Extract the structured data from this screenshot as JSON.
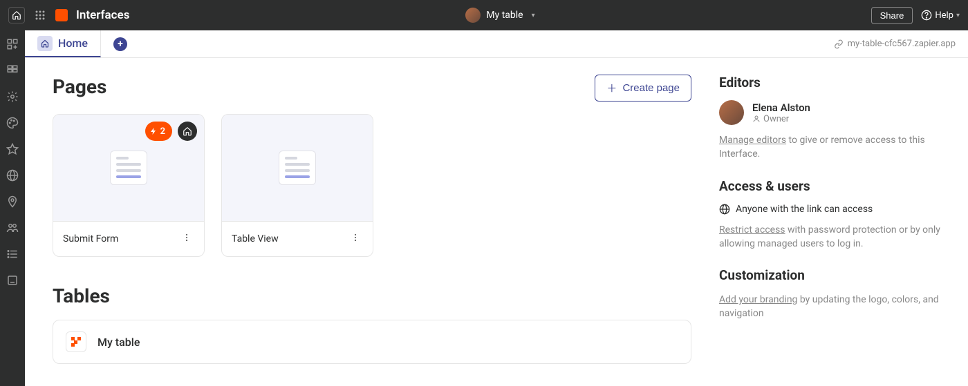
{
  "topbar": {
    "title": "Interfaces",
    "workspace_name": "My table",
    "share_label": "Share",
    "help_label": "Help"
  },
  "tabs": {
    "home_label": "Home",
    "url_display": "my-table-cfc567.zapier.app"
  },
  "pages_section": {
    "heading": "Pages",
    "create_btn": "Create page",
    "cards": [
      {
        "title": "Submit Form",
        "badge_count": "2",
        "has_home_badge": true
      },
      {
        "title": "Table View"
      }
    ]
  },
  "tables_section": {
    "heading": "Tables",
    "items": [
      {
        "name": "My table"
      }
    ]
  },
  "sidebar": {
    "editors_heading": "Editors",
    "editor_name": "Elena Alston",
    "editor_role": "Owner",
    "manage_editors_link": "Manage editors",
    "manage_editors_rest": " to give or remove access to this Interface.",
    "access_heading": "Access & users",
    "access_current": "Anyone with the link can access",
    "restrict_link": "Restrict access",
    "restrict_rest": " with password protection or by only allowing managed users to log in.",
    "custom_heading": "Customization",
    "branding_link": "Add your branding",
    "branding_rest": " by updating the logo, colors, and navigation"
  }
}
